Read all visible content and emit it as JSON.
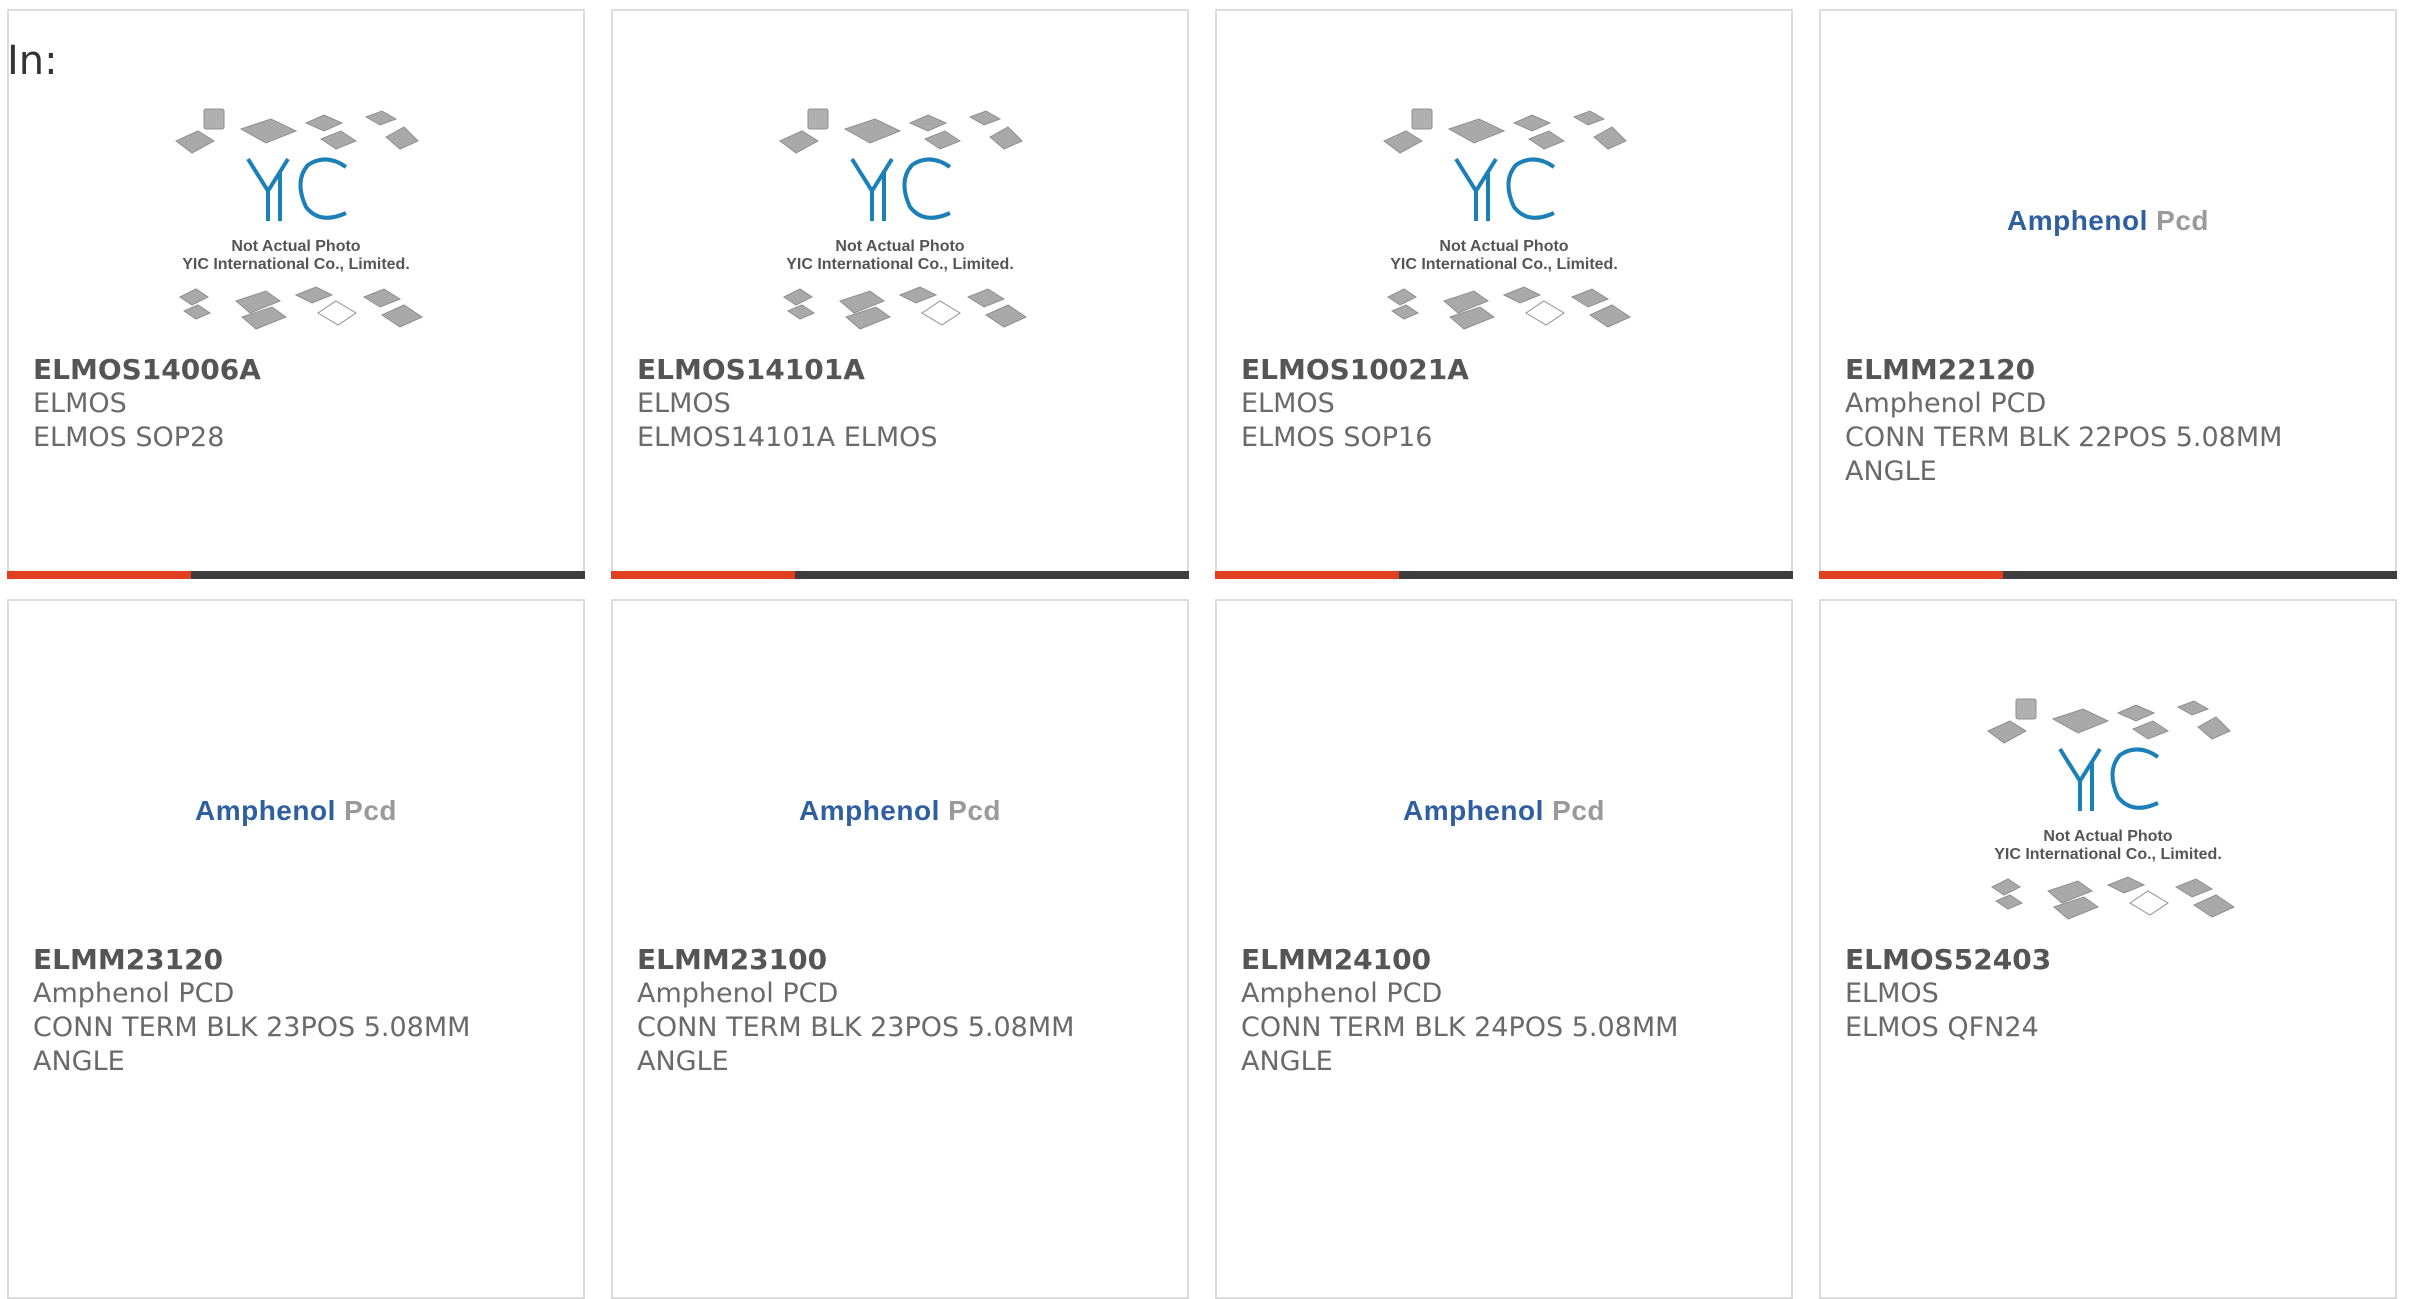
{
  "header": {
    "in_label": "In:"
  },
  "placeholder": {
    "yic_logo_text": "YIC",
    "line1": "Not Actual Photo",
    "line2": "YIC International Co., Limited."
  },
  "amphenol_logo": {
    "part1": "Amphenol",
    "part2": "Pcd"
  },
  "colors": {
    "accent": "#e0401f",
    "bar": "#3d3d3d",
    "border": "#dcdcdc",
    "text": "#6a6a6a"
  },
  "products": [
    {
      "part": "ELMOS14006A",
      "maker": "ELMOS",
      "desc": "ELMOS SOP28",
      "image": "yic-placeholder"
    },
    {
      "part": "ELMOS14101A",
      "maker": "ELMOS",
      "desc": "ELMOS14101A ELMOS",
      "image": "yic-placeholder"
    },
    {
      "part": "ELMOS10021A",
      "maker": "ELMOS",
      "desc": "ELMOS SOP16",
      "image": "yic-placeholder"
    },
    {
      "part": "ELMM22120",
      "maker": "Amphenol PCD",
      "desc": "CONN TERM BLK 22POS 5.08MM ANGLE",
      "image": "amphenol-logo"
    },
    {
      "part": "ELMM23120",
      "maker": "Amphenol PCD",
      "desc": "CONN TERM BLK 23POS 5.08MM ANGLE",
      "image": "amphenol-logo"
    },
    {
      "part": "ELMM23100",
      "maker": "Amphenol PCD",
      "desc": "CONN TERM BLK 23POS 5.08MM ANGLE",
      "image": "amphenol-logo"
    },
    {
      "part": "ELMM24100",
      "maker": "Amphenol PCD",
      "desc": "CONN TERM BLK 24POS 5.08MM ANGLE",
      "image": "amphenol-logo"
    },
    {
      "part": "ELMOS52403",
      "maker": "ELMOS",
      "desc": "ELMOS QFN24",
      "image": "yic-placeholder"
    }
  ]
}
